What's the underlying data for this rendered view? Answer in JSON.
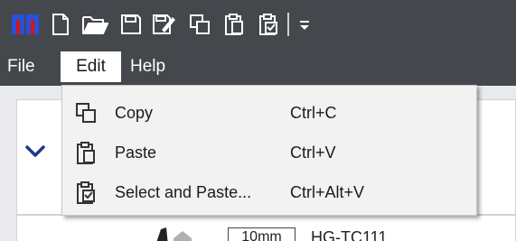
{
  "toolbar": {
    "icons": [
      "app-logo-icon",
      "new-file-icon",
      "open-folder-icon",
      "save-icon",
      "save-as-icon",
      "copy-icon",
      "paste-icon",
      "select-paste-icon",
      "customize-dropdown-icon"
    ]
  },
  "menubar": {
    "items": [
      {
        "label": "File",
        "active": false
      },
      {
        "label": "Edit",
        "active": true
      },
      {
        "label": "Help",
        "active": false
      }
    ]
  },
  "edit_menu": {
    "items": [
      {
        "label": "Copy",
        "shortcut": "Ctrl+C",
        "icon": "copy-icon"
      },
      {
        "label": "Paste",
        "shortcut": "Ctrl+V",
        "icon": "paste-icon"
      },
      {
        "label": "Select and Paste...",
        "shortcut": "Ctrl+Alt+V",
        "icon": "select-paste-icon"
      }
    ]
  },
  "background": {
    "size_value": "10mm",
    "part_label": "HG-TC111"
  },
  "colors": {
    "toolbar_bg": "#44474c",
    "logo_blue": "#2a4fd8",
    "logo_red": "#d01818",
    "chevron": "#1a3a8a"
  }
}
